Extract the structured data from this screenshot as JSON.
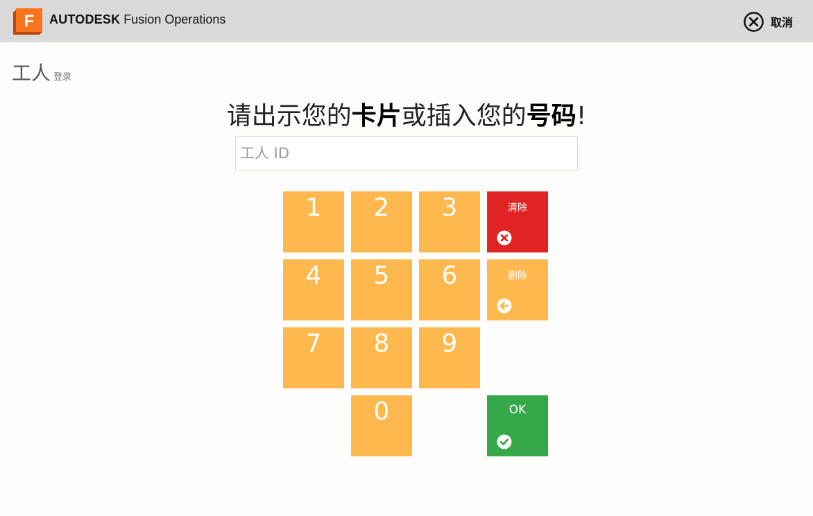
{
  "header": {
    "brand_bold": "AUTODESK",
    "brand_product": "Fusion Operations",
    "logo_letter": "F",
    "cancel_label": "取消"
  },
  "breadcrumb": {
    "section": "工人",
    "page": "登录"
  },
  "prompt": {
    "part1": "请出示您的",
    "bold1": "卡片",
    "part2": "或插入您的",
    "bold2": "号码",
    "end": "!"
  },
  "id_field": {
    "placeholder": "工人 ID",
    "value": ""
  },
  "keypad": {
    "digits": [
      "1",
      "2",
      "3",
      "4",
      "5",
      "6",
      "7",
      "8",
      "9",
      "0"
    ],
    "clear_label": "清除",
    "delete_label": "删除",
    "ok_label": "OK"
  },
  "colors": {
    "digit_key": "#ffb84d",
    "clear_key": "#e02424",
    "ok_key": "#35a84a",
    "topbar": "#d9d9d9",
    "logo": "#f26a1b"
  }
}
